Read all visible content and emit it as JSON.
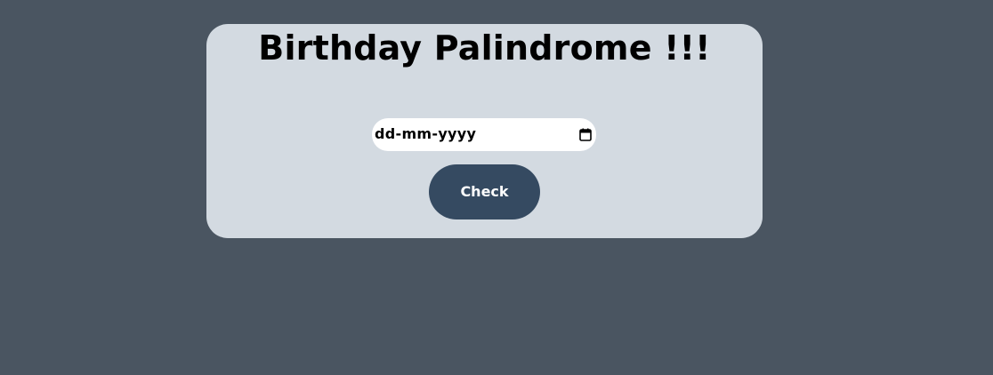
{
  "page": {
    "background_color": "#4a5561"
  },
  "card": {
    "title": "Birthday Palindrome !!!",
    "background_color": "#d3dae1"
  },
  "date_input": {
    "placeholder": "dd-mm-yyyy",
    "icon": "calendar-icon"
  },
  "check_button": {
    "label": "Check",
    "background_color": "#354a61"
  }
}
